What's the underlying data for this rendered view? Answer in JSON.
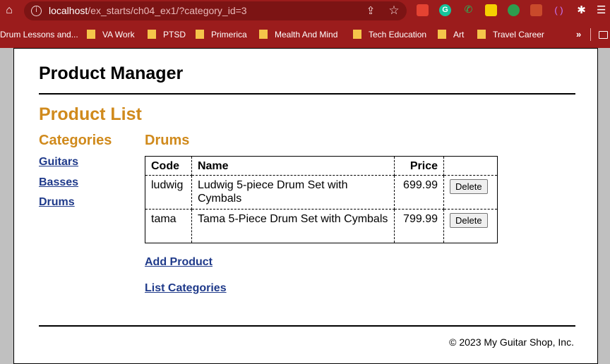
{
  "browser": {
    "url_host": "localhost",
    "url_path": "/ex_starts/ch04_ex1/?category_id=3",
    "bookmarks": [
      "Drum Lessons and...",
      "VA Work",
      "PTSD",
      "Primerica",
      "Mealth And Mind",
      "Tech Education",
      "Art",
      "Travel Career"
    ],
    "bookmarks_more": "»"
  },
  "page": {
    "header_title": "Product Manager",
    "heading": "Product List",
    "categories_heading": "Categories",
    "categories": [
      "Guitars",
      "Basses",
      "Drums"
    ],
    "current_category": "Drums",
    "table": {
      "columns": [
        "Code",
        "Name",
        "Price",
        ""
      ],
      "rows": [
        {
          "code": "ludwig",
          "name": "Ludwig 5-piece Drum Set with Cymbals",
          "price": "699.99",
          "action": "Delete"
        },
        {
          "code": "tama",
          "name": "Tama 5-Piece Drum Set with Cymbals",
          "price": "799.99",
          "action": "Delete"
        }
      ]
    },
    "add_product": "Add Product",
    "list_categories": "List Categories",
    "footer": "© 2023 My Guitar Shop, Inc."
  },
  "colors": {
    "chrome": "#9b1c1c",
    "heading_orange": "#d08a1c",
    "link_blue": "#1f3a8a"
  },
  "icons": {
    "toolbar": [
      "home-icon",
      "info-icon",
      "share-icon",
      "star-icon",
      "puzzle-icon",
      "menu-icon"
    ],
    "bookmark": "folder-icon"
  }
}
